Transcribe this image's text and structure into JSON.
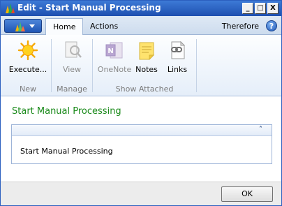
{
  "window": {
    "title": "Edit - Start Manual Processing",
    "controls": {
      "minimize": "_",
      "maximize": "□",
      "close": "X"
    }
  },
  "ribbon": {
    "tabs": [
      {
        "label": "Home",
        "active": true
      },
      {
        "label": "Actions",
        "active": false
      }
    ],
    "right_label": "Therefore",
    "help_glyph": "?",
    "groups": [
      {
        "label": "New",
        "buttons": [
          {
            "label": "Execute...",
            "icon": "execute-star-icon",
            "enabled": true
          }
        ]
      },
      {
        "label": "Manage",
        "buttons": [
          {
            "label": "View",
            "icon": "view-document-icon",
            "enabled": false
          }
        ]
      },
      {
        "label": "Show Attached",
        "buttons": [
          {
            "label": "OneNote",
            "icon": "onenote-icon",
            "enabled": false
          },
          {
            "label": "Notes",
            "icon": "notes-icon",
            "enabled": true
          },
          {
            "label": "Links",
            "icon": "links-icon",
            "enabled": true
          }
        ]
      }
    ]
  },
  "content": {
    "page_title": "Start Manual Processing",
    "fasttab": {
      "collapse_glyph": "˄",
      "field_label": "Start Manual Processing"
    }
  },
  "footer": {
    "ok_label": "OK"
  },
  "colors": {
    "title_bar": "#1e4fb0",
    "page_title": "#1a8a1a",
    "accent": "#3d7ad6"
  }
}
